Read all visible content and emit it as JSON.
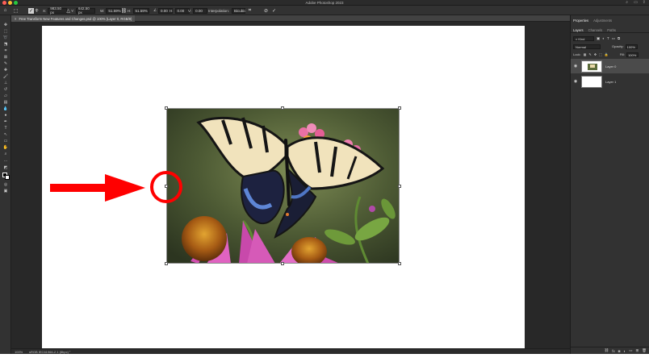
{
  "app": {
    "title": "Adobe Photoshop 2023"
  },
  "options_bar": {
    "x_value": "983.50 px",
    "y_value": "642.50 px",
    "w_value": "51.59%",
    "h_value": "51.59%",
    "angle_value": "0.00",
    "h_skew_value": "0.00",
    "v_skew_value": "0.00",
    "interpolation_label": "Interpolation:",
    "interpolation_value": "Bicubic"
  },
  "document": {
    "tab_title": "Free Transform New Features and Changes.psd @ 100% (Layer 0, RGB/8)"
  },
  "status": {
    "zoom": "100%",
    "profile": "sRGB IEC61966-2.1 (8bpc)"
  },
  "panel": {
    "tabs": [
      "Properties",
      "Adjustments"
    ],
    "layer_tabs": [
      "Layers",
      "Channels",
      "Paths"
    ],
    "kind_label": "Kind",
    "blend_mode": "Normal",
    "opacity_label": "Opacity:",
    "opacity_value": "100%",
    "lock_label": "Lock:",
    "fill_label": "Fill:",
    "fill_value": "100%",
    "layers": [
      {
        "name": "Layer 0"
      },
      {
        "name": "Layer 1"
      }
    ]
  },
  "annotations": {
    "accent_red": "#ff0000"
  }
}
